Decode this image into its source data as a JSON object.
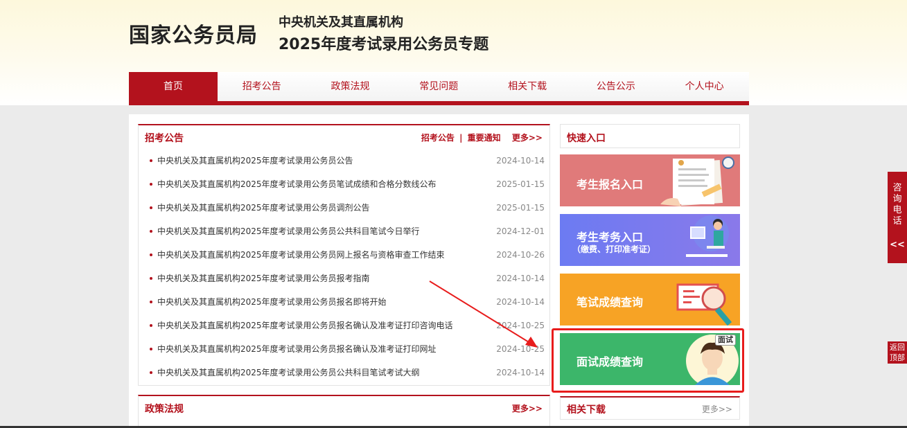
{
  "header": {
    "logo_text": "国家公务员局",
    "subtitle_line1": "中央机关及其直属机构",
    "subtitle_line2": "2025年度考试录用公务员专题"
  },
  "nav": {
    "items": [
      {
        "label": "首页",
        "active": true
      },
      {
        "label": "招考公告"
      },
      {
        "label": "政策法规"
      },
      {
        "label": "常见问题"
      },
      {
        "label": "相关下载"
      },
      {
        "label": "公告公示"
      },
      {
        "label": "个人中心"
      }
    ]
  },
  "announcements": {
    "title": "招考公告",
    "link1": "招考公告",
    "separator": "|",
    "link2": "重要通知",
    "more": "更多>>",
    "items": [
      {
        "title": "中央机关及其直属机构2025年度考试录用公务员公告",
        "date": "2024-10-14"
      },
      {
        "title": "中央机关及其直属机构2025年度考试录用公务员笔试成绩和合格分数线公布",
        "date": "2025-01-15"
      },
      {
        "title": "中央机关及其直属机构2025年度考试录用公务员调剂公告",
        "date": "2025-01-15"
      },
      {
        "title": "中央机关及其直属机构2025年度考试录用公务员公共科目笔试今日举行",
        "date": "2024-12-01"
      },
      {
        "title": "中央机关及其直属机构2025年度考试录用公务员网上报名与资格审查工作结束",
        "date": "2024-10-26"
      },
      {
        "title": "中央机关及其直属机构2025年度考试录用公务员报考指南",
        "date": "2024-10-14"
      },
      {
        "title": "中央机关及其直属机构2025年度考试录用公务员报名即将开始",
        "date": "2024-10-14"
      },
      {
        "title": "中央机关及其直属机构2025年度考试录用公务员报名确认及准考证打印咨询电话",
        "date": "2024-10-25"
      },
      {
        "title": "中央机关及其直属机构2025年度考试录用公务员报名确认及准考证打印网址",
        "date": "2024-10-25"
      },
      {
        "title": "中央机关及其直属机构2025年度考试录用公务员公共科目笔试考试大纲",
        "date": "2024-10-14"
      }
    ]
  },
  "policy": {
    "title": "政策法规",
    "more": "更多>>"
  },
  "quick": {
    "title": "快速入口",
    "banners": [
      {
        "label": "考生报名入口",
        "color": "#e07a7a"
      },
      {
        "label": "考生考务入口",
        "sub": "（缴费、打印准考证）",
        "color": "#6f7ef0"
      },
      {
        "label": "笔试成绩查询",
        "color": "#f7a325"
      },
      {
        "label": "面试成绩查询",
        "badge": "面试",
        "color": "#3cb66a"
      }
    ]
  },
  "downloads": {
    "title": "相关下载",
    "more": "更多>>"
  },
  "side": {
    "consult_label": "咨询电话",
    "consult_arrow": "<<",
    "backtop_label": "返回顶部"
  }
}
